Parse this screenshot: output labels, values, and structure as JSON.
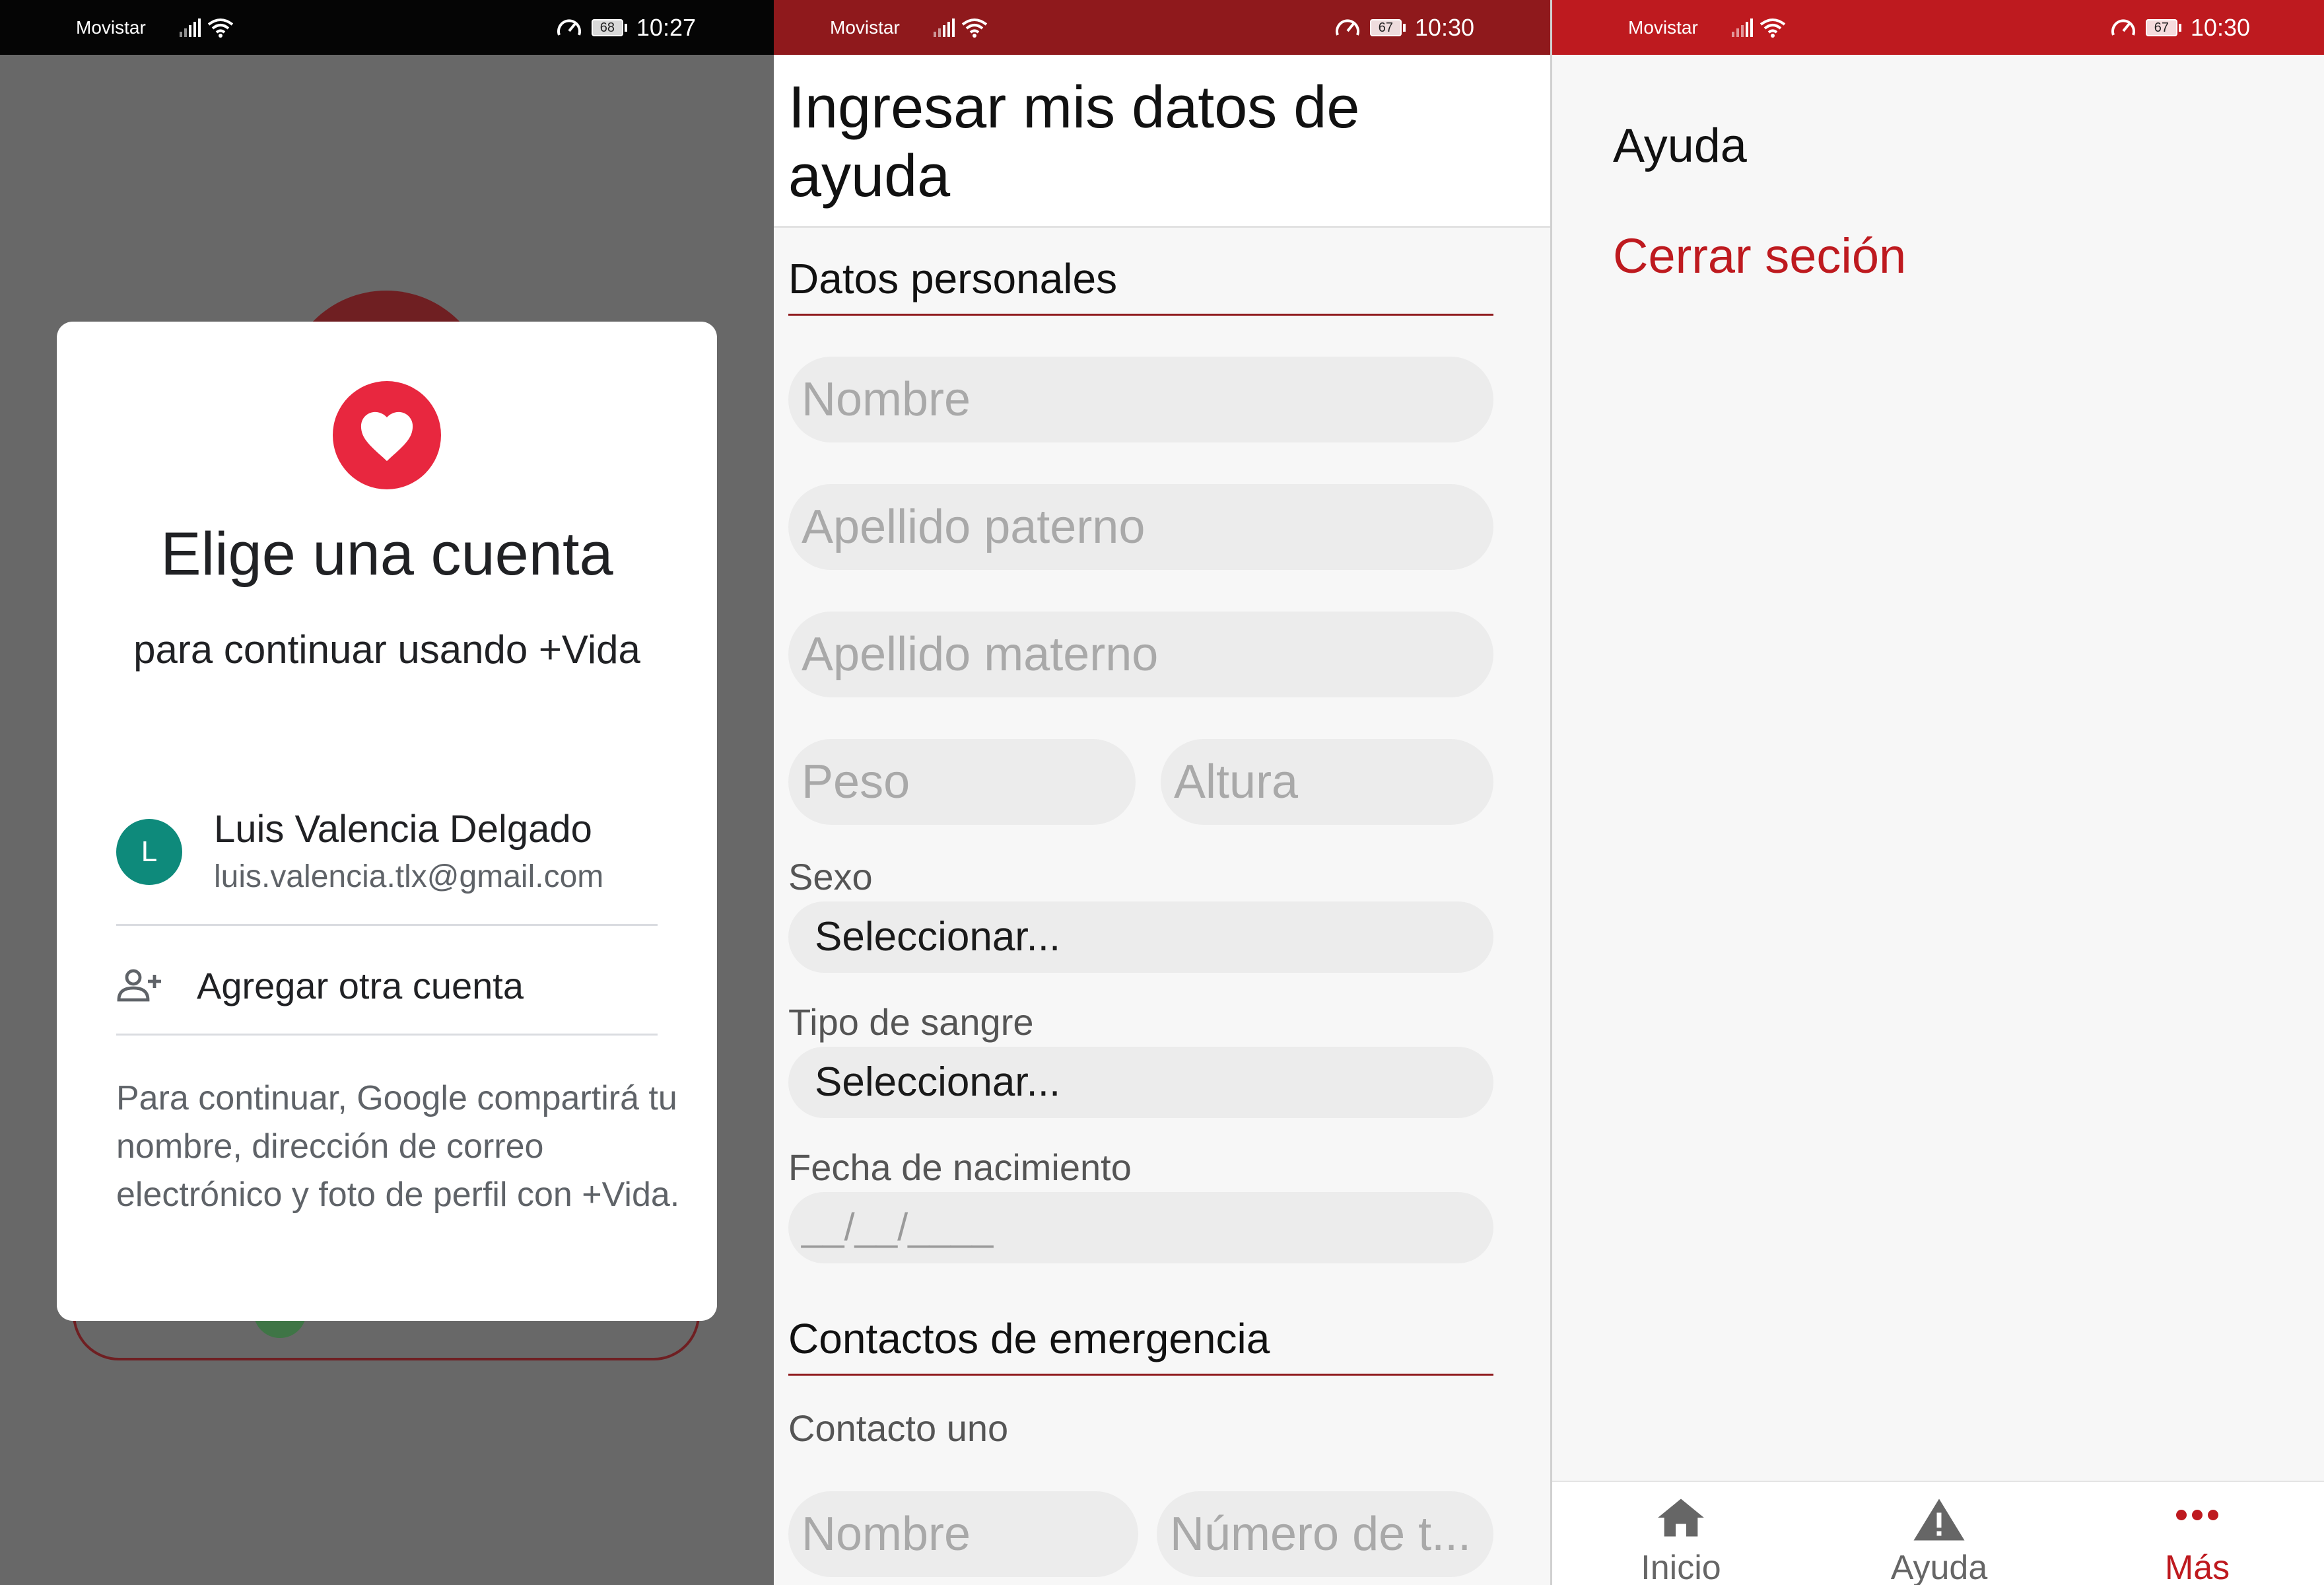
{
  "panel1": {
    "status": {
      "carrier": "Movistar",
      "battery": "68",
      "time": "10:27"
    },
    "dialog": {
      "icon": "heart-icon",
      "title": "Elige una cuenta",
      "subtitle": "para continuar usando +Vida",
      "account": {
        "initial": "L",
        "name": "Luis Valencia Delgado",
        "email": "luis.valencia.tlx@gmail.com"
      },
      "add_account_label": "Agregar otra cuenta",
      "note": "Para continuar, Google compartirá tu nombre, dirección de correo electrónico y foto de perfil con +Vida."
    },
    "colors": {
      "heart_badge": "#e8273f",
      "avatar": "#0e8a7b",
      "status_bar": "#050505"
    }
  },
  "panel2": {
    "status": {
      "carrier": "Movistar",
      "battery": "67",
      "time": "10:30"
    },
    "title": "Ingresar mis datos de ayuda",
    "section_personal": "Datos personales",
    "placeholders": {
      "nombre": "Nombre",
      "apellido_paterno": "Apellido paterno",
      "apellido_materno": "Apellido materno",
      "peso": "Peso",
      "altura": "Altura"
    },
    "sexo": {
      "label": "Sexo",
      "value": "Seleccionar..."
    },
    "tipo_sangre": {
      "label": "Tipo de sangre",
      "value": "Seleccionar..."
    },
    "fecha": {
      "label": "Fecha de nacimiento",
      "mask": "__/__/____"
    },
    "section_emergency": "Contactos de emergencia",
    "contact_one": {
      "label": "Contacto uno",
      "nombre_placeholder": "Nombre",
      "numero_placeholder": "Número de t..."
    },
    "colors": {
      "status_bar": "#8f191c",
      "accent": "#8f191c"
    }
  },
  "panel3": {
    "status": {
      "carrier": "Movistar",
      "battery": "67",
      "time": "10:30"
    },
    "menu": {
      "ayuda": "Ayuda",
      "cerrar": "Cerrar seción"
    },
    "tabs": [
      {
        "label": "Inicio",
        "icon": "home-icon"
      },
      {
        "label": "Ayuda",
        "icon": "warning-icon"
      },
      {
        "label": "Más",
        "icon": "more-dots-icon",
        "active": true
      }
    ],
    "colors": {
      "status_bar": "#be1a1f",
      "accent": "#be1a1f"
    }
  }
}
